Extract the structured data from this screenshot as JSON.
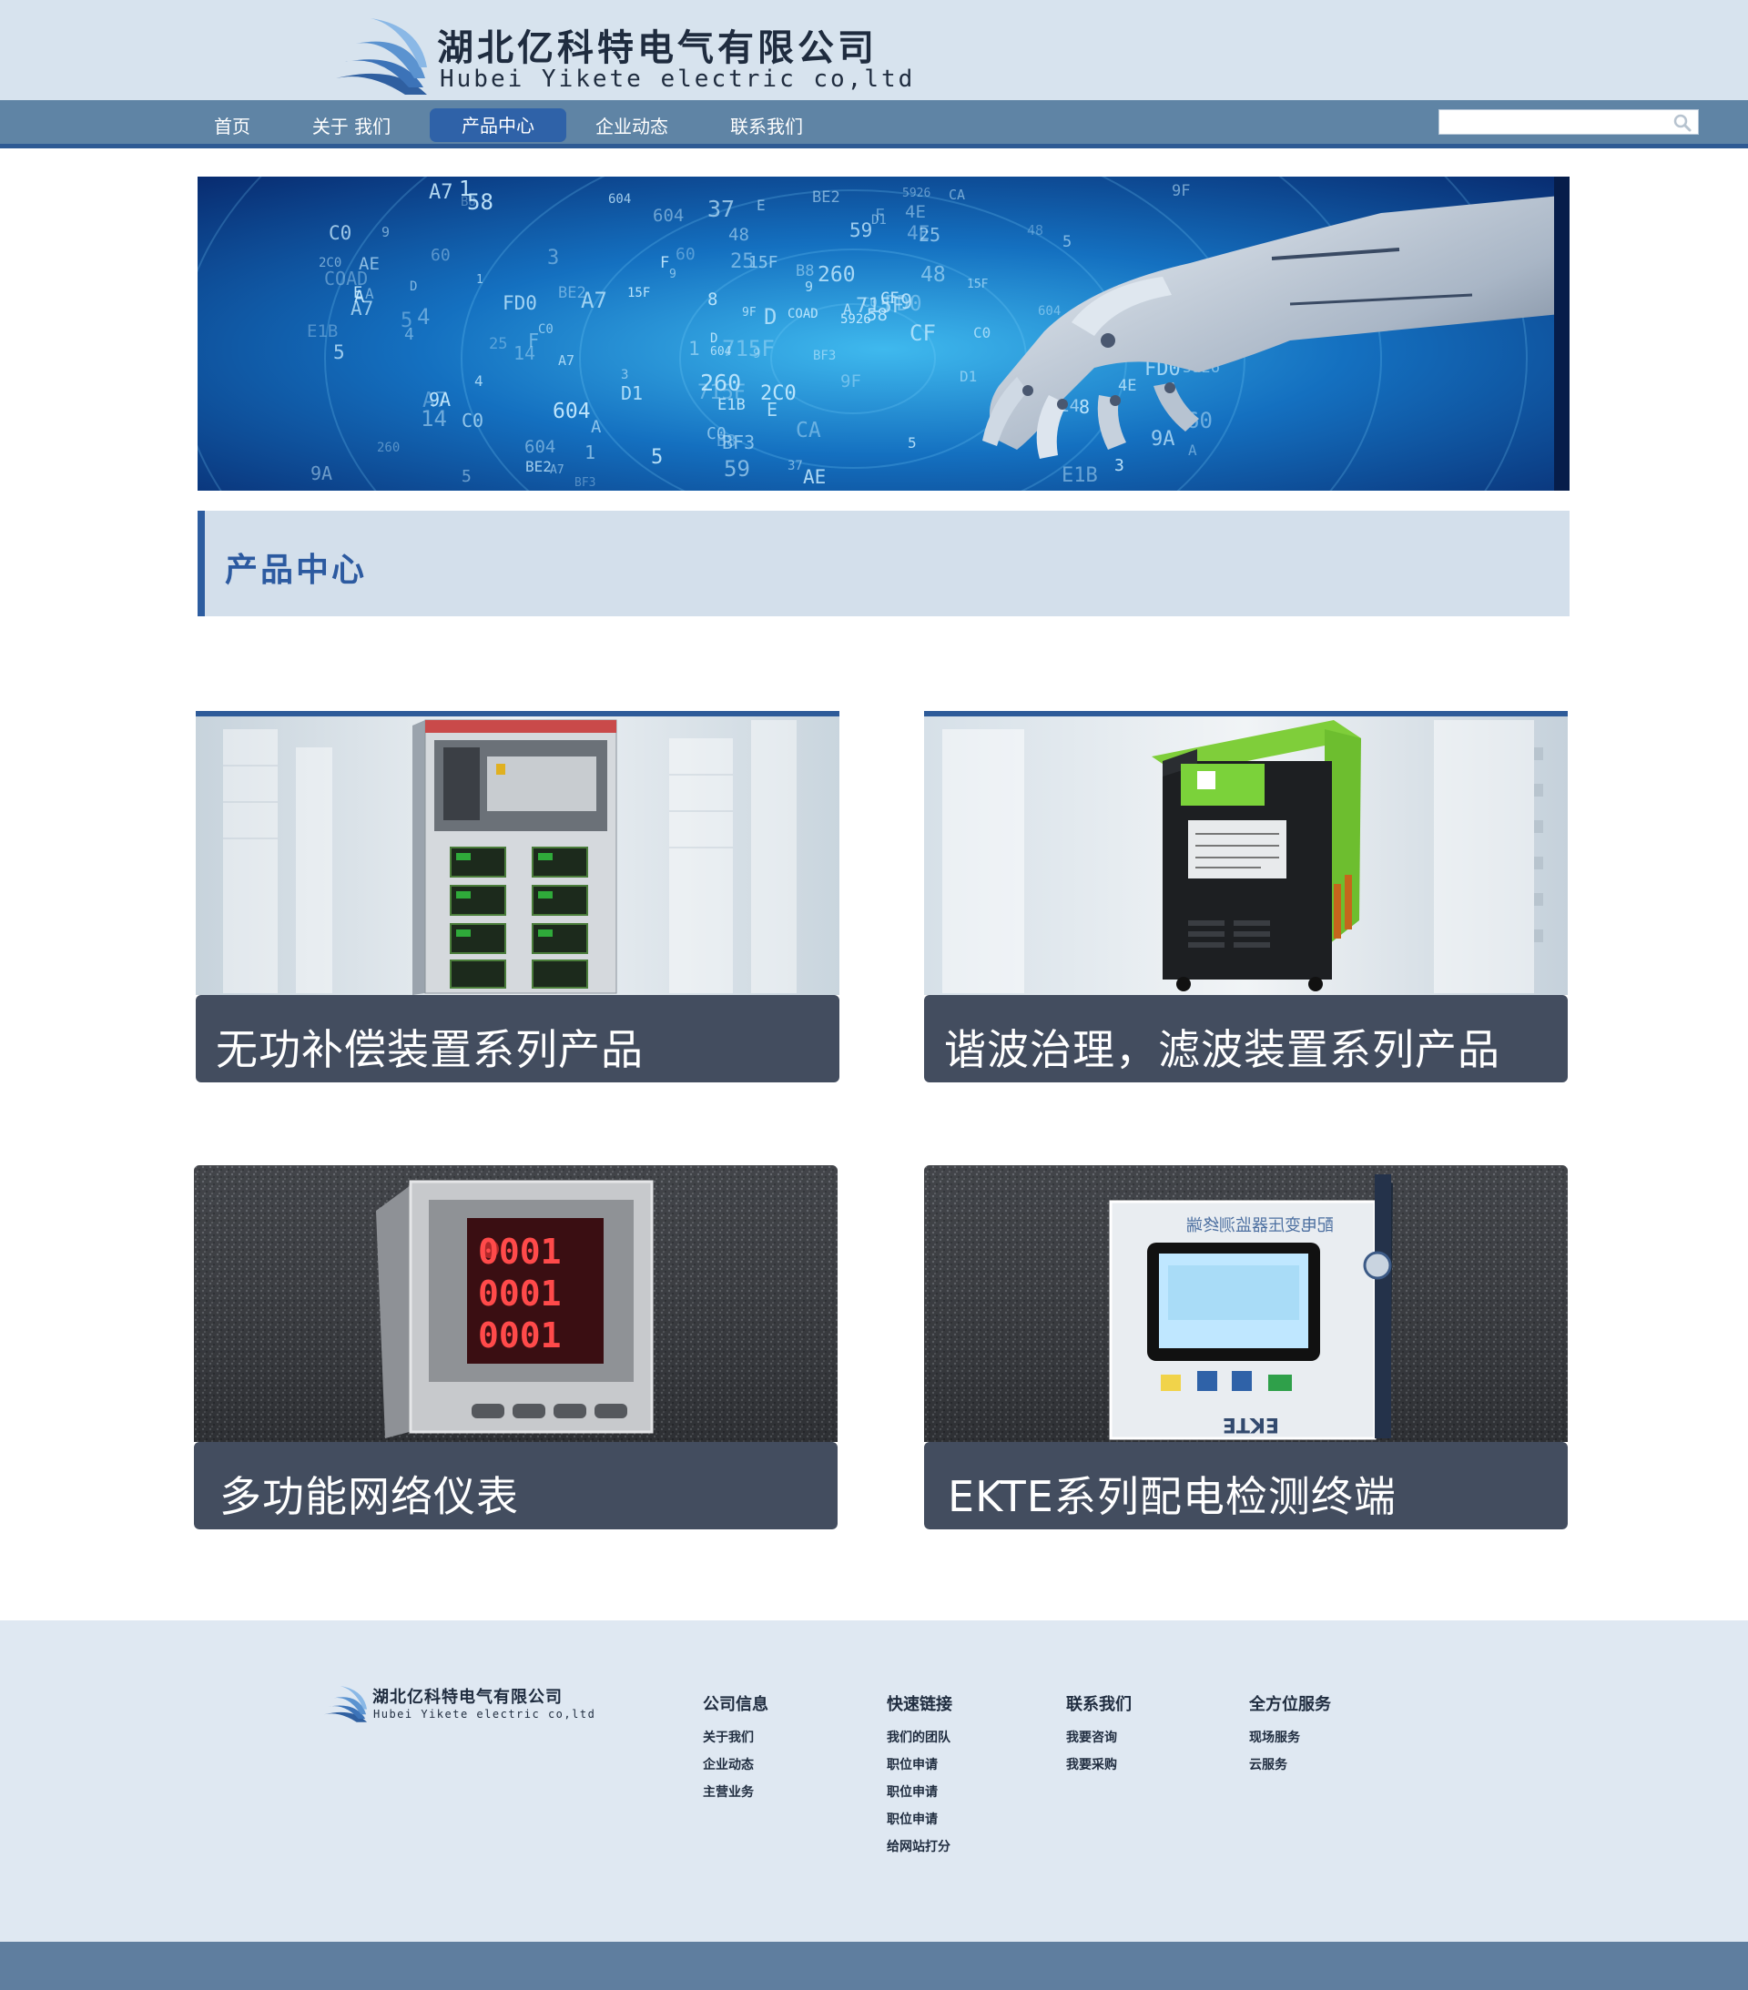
{
  "header": {
    "company_cn": "湖北亿科特电气有限公司",
    "company_en": "Hubei Yikete electric co,ltd"
  },
  "nav": {
    "items": [
      {
        "label": "首页"
      },
      {
        "label": "关于 我们"
      },
      {
        "label": "产品中心"
      },
      {
        "label": "企业动态"
      },
      {
        "label": "联系我们"
      }
    ],
    "active": "产品中心",
    "search": {
      "value": "",
      "placeholder": ""
    }
  },
  "banner": {
    "matrix_glyphs": [
      "9",
      "D",
      "A",
      "4E",
      "25",
      "58",
      "4",
      "1",
      "5",
      "9",
      "15F",
      "604",
      "715F",
      "60",
      "A7",
      "B8",
      "C0",
      "3",
      "604",
      "9A",
      "BE2",
      "FD0",
      "A7",
      "5926",
      "BF3",
      "14",
      "C0",
      "5",
      "B8",
      "CA",
      "E",
      "A",
      "48",
      "F",
      "9F",
      "E1B",
      "D1",
      "260",
      "1",
      "8",
      "COAD",
      "CF",
      "59",
      "2C0",
      "AE",
      "37"
    ]
  },
  "section": {
    "title": "产品中心"
  },
  "products": [
    {
      "title": "无功补偿装置系列产品",
      "image": "compensation-cabinet"
    },
    {
      "title": "谐波治理，滤波装置系列产品",
      "image": "green-filter-unit"
    },
    {
      "title": "多功能网络仪表",
      "image": "network-meter",
      "display_readings": [
        "0001",
        "0001",
        "0001"
      ]
    },
    {
      "title": "EKTE系列配电检测终端",
      "image": "distribution-terminal",
      "device_text": [
        "EKTE",
        "配电变压器监测终端"
      ]
    }
  ],
  "footer": {
    "company_cn": "湖北亿科特电气有限公司",
    "company_en": "Hubei Yikete electric co,ltd",
    "columns": [
      {
        "heading": "公司信息",
        "links": [
          "关于我们",
          "企业动态",
          "主营业务"
        ]
      },
      {
        "heading": "快速链接",
        "links": [
          "我们的团队",
          "职位申请",
          "职位申请",
          "职位申请",
          "给网站打分"
        ]
      },
      {
        "heading": "联系我们",
        "links": [
          "我要咨询",
          "我要采购"
        ]
      },
      {
        "heading": "全方位服务",
        "links": [
          "现场服务",
          "云服务"
        ]
      }
    ]
  },
  "colors": {
    "header_bg": "#d7e3ee",
    "nav_bg": "#5f84a5",
    "nav_active": "#2f62a8",
    "accent": "#2d5da0",
    "caption_bg": "#434d5f",
    "footer_bg": "#dfe8f2",
    "footer_bar": "#5f7e9f"
  }
}
